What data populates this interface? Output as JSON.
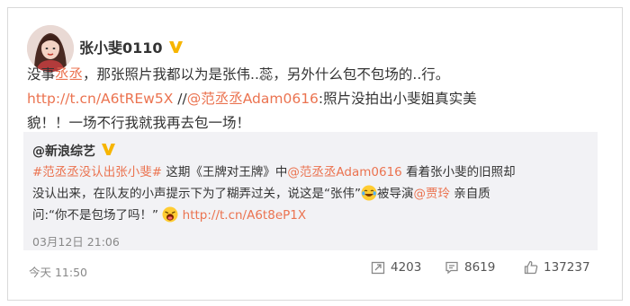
{
  "user": {
    "name": "张小斐0110"
  },
  "post": {
    "line1": {
      "prefix": "没事",
      "mention1": "丞丞",
      "suffix": "，那张照片我都以为是张伟..蕊，另外什么包不包场的..行。"
    },
    "line2": {
      "url": "http://t.cn/A6tREw5X",
      "sep": " //",
      "mention2": "@范丞丞Adam0616",
      "text": ":照片没拍出小斐姐真实美"
    },
    "line3": "貌！！一场不行我就我再去包一场！"
  },
  "quoted": {
    "author": "@新浪综艺",
    "hashtag": "#范丞丞没认出张小斐#",
    "t1": " 这期《王牌对王牌》中",
    "mention": "@范丞丞Adam0616",
    "t2": " 看着张小斐的旧照却",
    "line2_text": "没认出来，在队友的小声提示下为了糊弄过关，说这是“张伟”",
    "t3": "被导演",
    "mention2": "@贾玲",
    "t4": " 亲自质",
    "line3_text": "问:“你不是包场了吗！”",
    "url": "http://t.cn/A6t8eP1X",
    "time": "03月12日 21:06"
  },
  "footer": {
    "time": "今天 11:50",
    "reposts": "4203",
    "comments": "8619",
    "likes": "137237"
  },
  "icons": {
    "verified": "verified-v-badge-icon",
    "repost": "repost-icon",
    "comment": "comment-icon",
    "like": "thumbs-up-icon",
    "emoji_laugh": "laughing-tears-emoji",
    "emoji_shout": "shouting-emoji"
  },
  "colors": {
    "link": "#eb7350",
    "badge": "#f7b500",
    "quote_bg": "#f2f2f5"
  }
}
